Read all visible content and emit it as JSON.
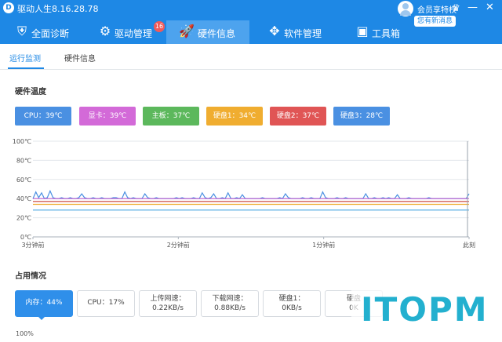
{
  "app": {
    "title": "驱动人生8.16.28.78",
    "logo_glyph": "D"
  },
  "account": {
    "vip_label": "会员享特权",
    "msg_badge": "您有新消息"
  },
  "window": {
    "min_glyph": "—",
    "close_glyph": "✕"
  },
  "nav": {
    "tabs": [
      {
        "label": "全面诊断",
        "icon": "shield-icon",
        "glyph": "⛨",
        "active": false
      },
      {
        "label": "驱动管理",
        "icon": "gear-icon",
        "glyph": "⚙",
        "active": false,
        "badge": "16"
      },
      {
        "label": "硬件信息",
        "icon": "rocket-icon",
        "glyph": "🚀",
        "active": true
      },
      {
        "label": "软件管理",
        "icon": "apps-icon",
        "glyph": "✥",
        "active": false
      },
      {
        "label": "工具箱",
        "icon": "toolbox-icon",
        "glyph": "▣",
        "active": false
      }
    ]
  },
  "subtabs": [
    {
      "label": "运行监测",
      "active": true
    },
    {
      "label": "硬件信息",
      "active": false
    }
  ],
  "temperature": {
    "title": "硬件温度",
    "sensors": [
      {
        "label": "CPU：39℃",
        "color": "#4a90e2"
      },
      {
        "label": "显卡：39℃",
        "color": "#d36ad8"
      },
      {
        "label": "主板：37℃",
        "color": "#5cb85c"
      },
      {
        "label": "硬盘1：34℃",
        "color": "#f0ad30"
      },
      {
        "label": "硬盘2：37℃",
        "color": "#e05555"
      },
      {
        "label": "硬盘3：28℃",
        "color": "#4a90e2"
      }
    ]
  },
  "chart_data": {
    "type": "line",
    "ylim": [
      0,
      100
    ],
    "y_ticks": [
      "0℃",
      "20℃",
      "40℃",
      "60℃",
      "80℃",
      "100℃"
    ],
    "x_ticks": [
      "3分钟前",
      "2分钟前",
      "1分钟前",
      "此刻"
    ],
    "series": [
      {
        "name": "CPU",
        "color": "#4a90e2",
        "values": [
          40,
          47,
          41,
          46,
          40,
          41,
          48,
          41,
          40,
          40,
          41,
          40,
          40,
          41,
          40,
          40,
          41,
          45,
          41,
          40,
          40,
          41,
          40,
          40,
          41,
          40,
          40,
          40,
          41,
          41,
          40,
          40,
          47,
          41,
          40,
          41,
          40,
          40,
          40,
          45,
          41,
          40,
          40,
          41,
          40,
          40,
          40,
          40,
          40,
          40,
          41,
          40,
          41,
          40,
          40,
          40,
          41,
          40,
          40,
          46,
          41,
          40,
          41,
          45,
          40,
          40,
          41,
          40,
          46,
          40,
          40,
          41,
          40,
          44,
          40,
          40,
          40,
          40,
          40,
          40,
          41,
          40,
          40,
          40,
          40,
          40,
          41,
          40,
          45,
          41,
          40,
          40,
          40,
          40,
          41,
          40,
          40,
          41,
          40,
          40,
          40,
          47,
          41,
          40,
          40,
          40,
          41,
          40,
          40,
          41,
          40,
          40,
          40,
          40,
          40,
          40,
          45,
          40,
          40,
          41,
          40,
          40,
          41,
          40,
          41,
          40,
          40,
          44,
          40,
          40,
          40,
          41,
          40,
          40,
          40,
          40,
          40,
          40,
          41,
          40,
          40,
          40,
          40,
          40,
          40,
          40,
          40,
          40,
          40,
          40,
          40,
          40,
          45
        ]
      },
      {
        "name": "显卡",
        "color": "#c05fd0",
        "values": [
          40,
          40,
          40,
          40,
          40,
          40,
          40,
          40,
          40,
          40,
          40,
          40,
          40,
          40,
          40,
          40,
          40,
          40,
          40,
          40,
          40,
          40,
          40,
          40,
          40,
          40,
          40,
          40,
          40,
          40,
          40,
          40,
          40,
          40,
          40,
          40,
          40,
          40,
          40,
          40,
          40,
          40,
          40,
          40,
          40,
          40,
          40,
          40,
          40,
          40,
          40,
          40,
          40,
          40,
          40,
          40,
          40,
          40,
          40,
          40,
          40,
          40,
          40,
          40,
          40,
          40,
          40,
          40,
          40,
          40,
          40,
          40,
          40,
          40,
          40,
          40,
          40,
          40,
          40,
          40,
          40,
          40,
          40,
          40,
          40,
          40,
          40,
          40,
          40,
          40,
          40,
          40,
          40,
          40,
          40,
          40,
          40,
          40,
          40,
          40,
          40,
          40,
          40,
          40,
          40,
          40,
          40,
          40,
          40,
          40,
          40,
          40,
          40,
          40,
          40,
          40,
          40,
          40,
          40,
          40,
          40,
          40,
          40,
          40,
          40,
          40,
          40,
          40,
          40,
          40,
          40,
          40,
          40,
          40,
          40,
          40,
          40,
          40,
          40,
          40,
          40,
          40,
          40,
          40,
          40,
          40,
          40,
          40,
          40,
          40,
          40,
          40,
          40,
          40,
          40,
          40,
          40,
          40,
          40
        ]
      },
      {
        "name": "主板",
        "color": "#5cb85c",
        "values": [
          37,
          37
        ]
      },
      {
        "name": "硬盘1",
        "color": "#f0ad30",
        "values": [
          34,
          34
        ]
      },
      {
        "name": "硬盘2",
        "color": "#e05555",
        "values": [
          37,
          37
        ]
      },
      {
        "name": "硬盘3",
        "color": "#4aa8e0",
        "values": [
          28,
          28
        ]
      }
    ]
  },
  "usage": {
    "title": "占用情况",
    "tiles": [
      {
        "line1": "内存：44%",
        "line2": "",
        "active": true
      },
      {
        "line1": "CPU：17%",
        "line2": "",
        "active": false
      },
      {
        "line1": "上传网速：",
        "line2": "0.22KB/s",
        "active": false
      },
      {
        "line1": "下载网速：",
        "line2": "0.88KB/s",
        "active": false
      },
      {
        "line1": "硬盘1：",
        "line2": "0KB/s",
        "active": false
      },
      {
        "line1": "硬盘",
        "line2": "0K",
        "active": false
      }
    ],
    "axis_top_label": "100%"
  },
  "watermark": {
    "text": "ITOPM"
  }
}
